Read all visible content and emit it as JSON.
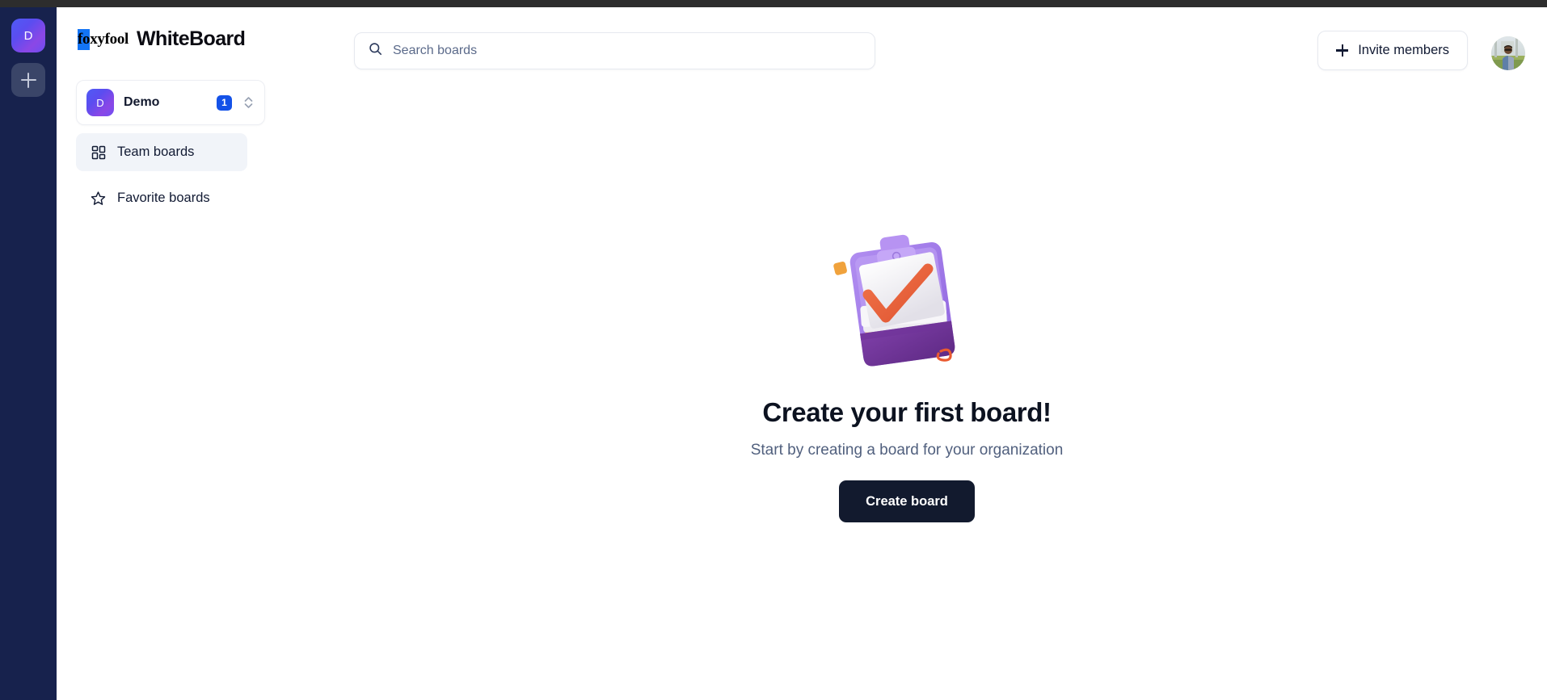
{
  "app": {
    "brand_mark_highlight": "fo",
    "brand_mark_rest": "xyfool",
    "brand_title": "WhiteBoard",
    "accent_blue": "#1452e8",
    "rail_color": "#17224d",
    "dark_button_color": "#121a2e"
  },
  "rail": {
    "workspace_initial": "D",
    "add_workspace_label": "+"
  },
  "search": {
    "placeholder": "Search boards",
    "value": "",
    "icon": "search-icon"
  },
  "header": {
    "invite_label": "Invite members",
    "invite_icon": "plus-icon",
    "avatar_label": "user-avatar"
  },
  "sidebar": {
    "workspace": {
      "initial": "D",
      "name": "Demo",
      "badge": "1",
      "chevrons_icon": "chevron-up-down-icon"
    },
    "items": [
      {
        "label": "Team boards",
        "icon": "layout-grid-icon",
        "active": true
      },
      {
        "label": "Favorite boards",
        "icon": "star-icon",
        "active": false
      }
    ]
  },
  "main": {
    "illustration": "clipboard-checkmark-illustration",
    "title": "Create your first board!",
    "subtitle": "Start by creating a board for your organization",
    "create_button": "Create board"
  }
}
